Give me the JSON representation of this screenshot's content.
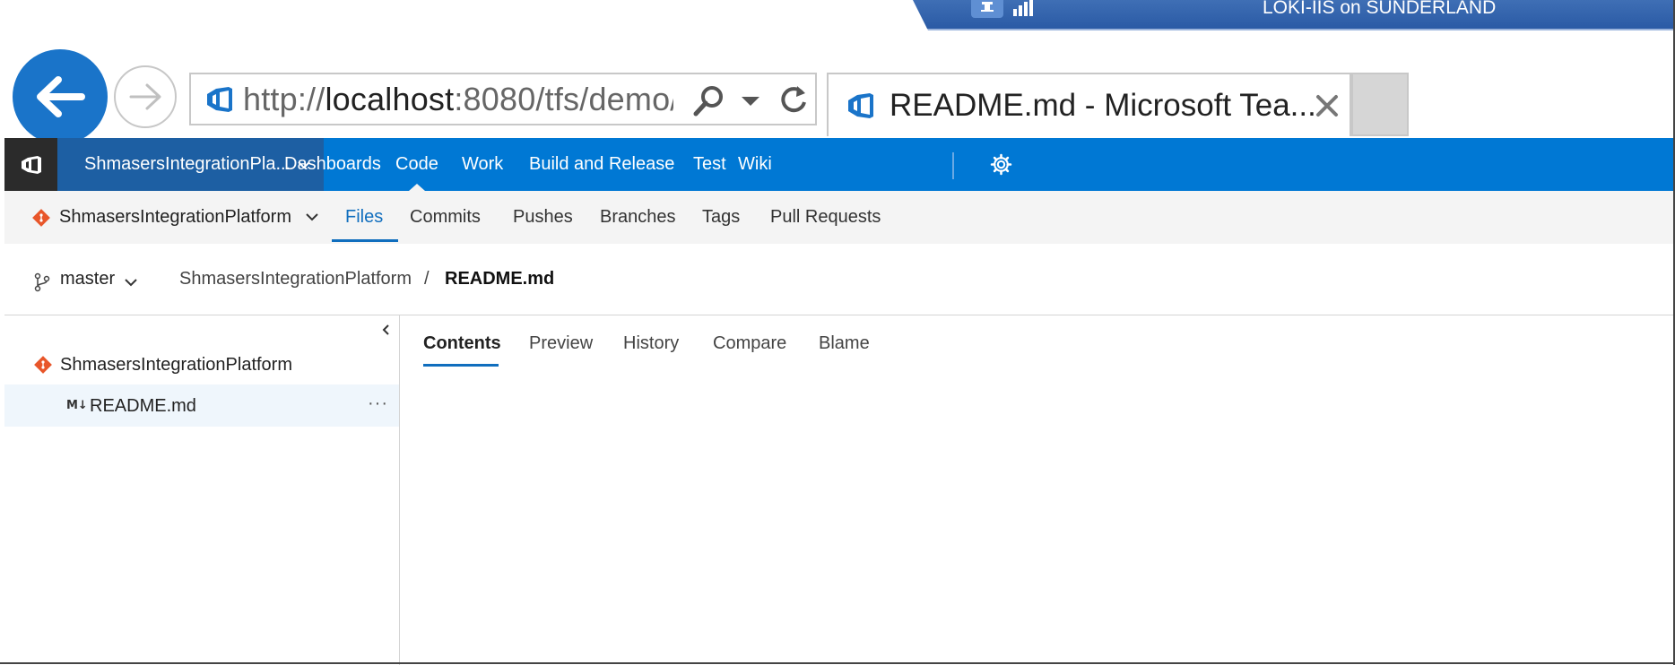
{
  "remote_session": {
    "title": "LOKI-IIS on SUNDERLAND",
    "icons": [
      "pin-icon",
      "signal-icon"
    ]
  },
  "browser": {
    "address": {
      "scheme": "http://",
      "host": "localhost",
      "rest": ":8080/tfs/demo/"
    },
    "tab_title": "README.md - Microsoft Tea...",
    "icons": [
      "back-icon",
      "forward-icon",
      "search-icon",
      "dropdown-icon",
      "refresh-icon",
      "close-icon"
    ]
  },
  "topnav": {
    "project": "ShmasersIntegrationPla...",
    "items": [
      "Dashboards",
      "Code",
      "Work",
      "Build and Release",
      "Test",
      "Wiki"
    ],
    "active": "Code",
    "colors": {
      "bar": "#0078d4",
      "project": "#1d5fa3",
      "logo": "#2b2b2b"
    }
  },
  "subnav": {
    "repo": "ShmasersIntegrationPlatform",
    "items": [
      "Files",
      "Commits",
      "Pushes",
      "Branches",
      "Tags",
      "Pull Requests"
    ],
    "active": "Files",
    "accent": "#106ebe"
  },
  "location": {
    "branch": "master",
    "breadcrumb_root": "ShmasersIntegrationPlatform",
    "separator": "/",
    "file": "README.md"
  },
  "tree": {
    "repo": "ShmasersIntegrationPlatform",
    "file_badge": "M↓",
    "file": "README.md",
    "more": "···"
  },
  "pane": {
    "tabs": [
      "Contents",
      "Preview",
      "History",
      "Compare",
      "Blame"
    ],
    "active": "Contents"
  }
}
